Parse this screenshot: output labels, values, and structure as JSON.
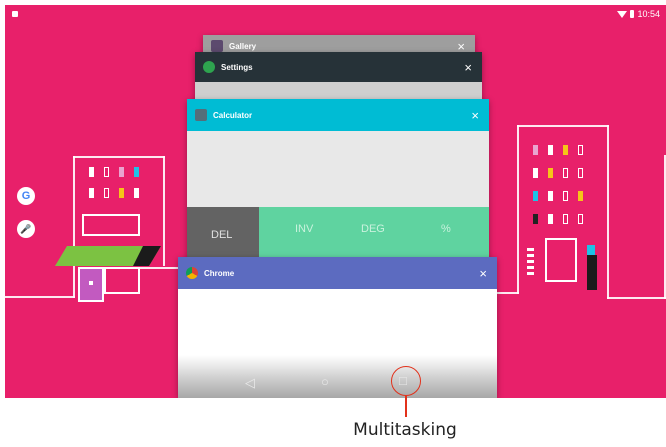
{
  "status_bar": {
    "time": "10:54"
  },
  "recents": [
    {
      "app": "Gallery",
      "close": "×",
      "header_color": "#9e9e9e"
    },
    {
      "app": "Settings",
      "close": "×",
      "header_color": "#263238"
    },
    {
      "app": "Calculator",
      "close": "×",
      "header_color": "#00bcd4"
    },
    {
      "app": "Chrome",
      "close": "×",
      "header_color": "#5c6bc0"
    }
  ],
  "calculator": {
    "keys": [
      "DEL",
      "INV",
      "DEG",
      "%"
    ]
  },
  "home_shortcuts": {
    "google": "G",
    "mic": "🎤"
  },
  "nav": {
    "back": "◁",
    "home": "○",
    "recents": "□"
  },
  "annotation": {
    "label": "Multitasking",
    "color": "#e2311b"
  }
}
